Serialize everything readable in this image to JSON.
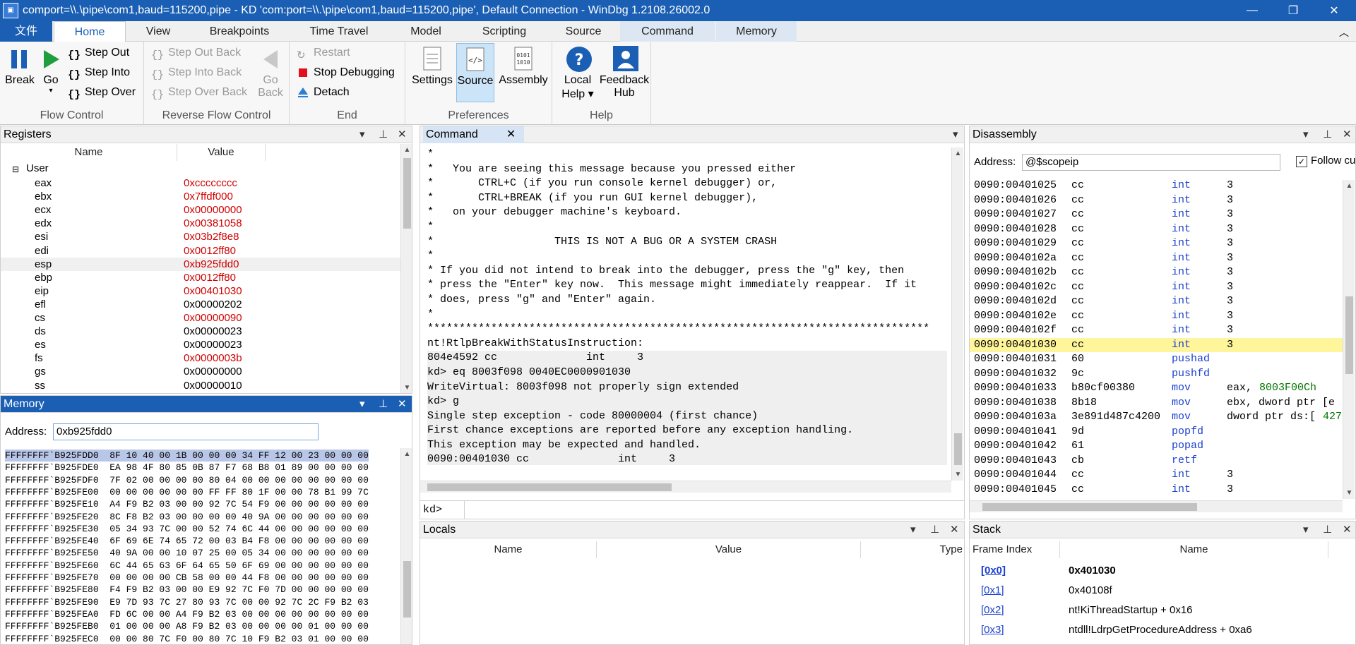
{
  "window": {
    "title": "comport=\\\\.\\pipe\\com1,baud=115200,pipe - KD 'com:port=\\\\.\\pipe\\com1,baud=115200,pipe', Default Connection  - WinDbg 1.2108.26002.0",
    "controls": [
      "—",
      "❐",
      "✕"
    ]
  },
  "ribbon_tabs": [
    "文件",
    "Home",
    "View",
    "Breakpoints",
    "Time Travel",
    "Model",
    "Scripting",
    "Source",
    "Command",
    "Memory"
  ],
  "ribbon": {
    "flow": {
      "label": "Flow Control",
      "break": "Break",
      "go": "Go",
      "step_out": "Step Out",
      "step_into": "Step Into",
      "step_over": "Step Over"
    },
    "reverse": {
      "label": "Reverse Flow Control",
      "step_out_back": "Step Out Back",
      "step_into_back": "Step Into Back",
      "step_over_back": "Step Over Back",
      "go_back_1": "Go",
      "go_back_2": "Back"
    },
    "end": {
      "label": "End",
      "restart": "Restart",
      "stop": "Stop Debugging",
      "detach": "Detach"
    },
    "prefs": {
      "label": "Preferences",
      "settings": "Settings",
      "source": "Source",
      "assembly": "Assembly"
    },
    "help": {
      "label": "Help",
      "local_help_1": "Local",
      "local_help_2": "Help ▾",
      "feedback_1": "Feedback",
      "feedback_2": "Hub"
    }
  },
  "registers": {
    "title": "Registers",
    "col_name": "Name",
    "col_value": "Value",
    "group": "User",
    "items": [
      [
        "eax",
        "0xcccccccc"
      ],
      [
        "ebx",
        "0x7ffdf000"
      ],
      [
        "ecx",
        "0x00000000"
      ],
      [
        "edx",
        "0x00381058"
      ],
      [
        "esi",
        "0x03b2f8e8"
      ],
      [
        "edi",
        "0x0012ff80"
      ],
      [
        "esp",
        "0xb925fdd0"
      ],
      [
        "ebp",
        "0x0012ff80"
      ],
      [
        "eip",
        "0x00401030"
      ],
      [
        "efl",
        "0x00000202"
      ],
      [
        "cs",
        "0x00000090"
      ],
      [
        "ds",
        "0x00000023"
      ],
      [
        "es",
        "0x00000023"
      ],
      [
        "fs",
        "0x0000003b"
      ],
      [
        "gs",
        "0x00000000"
      ],
      [
        "ss",
        "0x00000010"
      ]
    ]
  },
  "memory": {
    "title": "Memory",
    "address_label": "Address:",
    "address_value": "0xb925fdd0",
    "lines": [
      "FFFFFFFF`B925FDD0  8F 10 40 00 1B 00 00 00 34 FF 12 00 23 00 00 00",
      "FFFFFFFF`B925FDE0  EA 98 4F 80 85 0B 87 F7 68 B8 01 89 00 00 00 00",
      "FFFFFFFF`B925FDF0  7F 02 00 00 00 00 80 04 00 00 00 00 00 00 00 00",
      "FFFFFFFF`B925FE00  00 00 00 00 00 00 FF FF 80 1F 00 00 78 B1 99 7C",
      "FFFFFFFF`B925FE10  A4 F9 B2 03 00 00 92 7C 54 F9 00 00 00 00 00 00",
      "FFFFFFFF`B925FE20  8C F8 B2 03 00 00 00 00 40 9A 00 00 00 00 00 00",
      "FFFFFFFF`B925FE30  05 34 93 7C 00 00 52 74 6C 44 00 00 00 00 00 00",
      "FFFFFFFF`B925FE40  6F 69 6E 74 65 72 00 03 B4 F8 00 00 00 00 00 00",
      "FFFFFFFF`B925FE50  40 9A 00 00 10 07 25 00 05 34 00 00 00 00 00 00",
      "FFFFFFFF`B925FE60  6C 44 65 63 6F 64 65 50 6F 69 00 00 00 00 00 00",
      "FFFFFFFF`B925FE70  00 00 00 00 CB 58 00 00 44 F8 00 00 00 00 00 00",
      "FFFFFFFF`B925FE80  F4 F9 B2 03 00 00 E9 92 7C F0 7D 00 00 00 00 00",
      "FFFFFFFF`B925FE90  E9 7D 93 7C 27 80 93 7C 00 00 92 7C 2C F9 B2 03",
      "FFFFFFFF`B925FEA0  FD 6C 00 00 A4 F9 B2 03 00 00 00 00 00 00 00 00",
      "FFFFFFFF`B925FEB0  01 00 00 00 A8 F9 B2 03 00 00 00 00 01 00 00 00",
      "FFFFFFFF`B925FEC0  00 00 80 7C F0 00 80 7C 10 F9 B2 03 01 00 00 00"
    ]
  },
  "command": {
    "tab": "Command",
    "prompt": "kd>",
    "lines": [
      "*",
      "*   You are seeing this message because you pressed either",
      "*       CTRL+C (if you run console kernel debugger) or,",
      "*       CTRL+BREAK (if you run GUI kernel debugger),",
      "*   on your debugger machine's keyboard.",
      "*",
      "*                   THIS IS NOT A BUG OR A SYSTEM CRASH",
      "*",
      "* If you did not intend to break into the debugger, press the \"g\" key, then",
      "* press the \"Enter\" key now.  This message might immediately reappear.  If it",
      "* does, press \"g\" and \"Enter\" again.",
      "*",
      "*******************************************************************************",
      "nt!RtlpBreakWithStatusInstruction:",
      "804e4592 cc              int     3",
      "kd> eq 8003f098 0040EC0000901030",
      "WriteVirtual: 8003f098 not properly sign extended",
      "kd> g",
      "Single step exception - code 80000004 (first chance)",
      "First chance exceptions are reported before any exception handling.",
      "This exception may be expected and handled.",
      "0090:00401030 cc              int     3"
    ]
  },
  "disassembly": {
    "title": "Disassembly",
    "address_label": "Address:",
    "address_value": "@$scopeip",
    "follow": "Follow cu",
    "lines": [
      [
        "0090:00401025",
        "cc",
        "int",
        "3",
        ""
      ],
      [
        "0090:00401026",
        "cc",
        "int",
        "3",
        ""
      ],
      [
        "0090:00401027",
        "cc",
        "int",
        "3",
        ""
      ],
      [
        "0090:00401028",
        "cc",
        "int",
        "3",
        ""
      ],
      [
        "0090:00401029",
        "cc",
        "int",
        "3",
        ""
      ],
      [
        "0090:0040102a",
        "cc",
        "int",
        "3",
        ""
      ],
      [
        "0090:0040102b",
        "cc",
        "int",
        "3",
        ""
      ],
      [
        "0090:0040102c",
        "cc",
        "int",
        "3",
        ""
      ],
      [
        "0090:0040102d",
        "cc",
        "int",
        "3",
        ""
      ],
      [
        "0090:0040102e",
        "cc",
        "int",
        "3",
        ""
      ],
      [
        "0090:0040102f",
        "cc",
        "int",
        "3",
        ""
      ],
      [
        "0090:00401030",
        "cc",
        "int",
        "3",
        ""
      ],
      [
        "0090:00401031",
        "60",
        "pushad",
        "",
        ""
      ],
      [
        "0090:00401032",
        "9c",
        "pushfd",
        "",
        ""
      ],
      [
        "0090:00401033",
        "b80cf00380",
        "mov",
        "eax, ",
        "8003F00Ch"
      ],
      [
        "0090:00401038",
        "8b18",
        "mov",
        "ebx, dword ptr [e",
        ""
      ],
      [
        "0090:0040103a",
        "3e891d487c4200",
        "mov",
        "dword ptr ds:[",
        ""
      ],
      [
        "0090:00401041",
        "9d",
        "popfd",
        "",
        ""
      ],
      [
        "0090:00401042",
        "61",
        "popad",
        "",
        ""
      ],
      [
        "0090:00401043",
        "cb",
        "retf",
        "",
        ""
      ],
      [
        "0090:00401044",
        "cc",
        "int",
        "3",
        ""
      ],
      [
        "0090:00401045",
        "cc",
        "int",
        "3",
        ""
      ]
    ],
    "tail": "427"
  },
  "locals": {
    "title": "Locals",
    "col_name": "Name",
    "col_value": "Value",
    "col_type": "Type"
  },
  "stack": {
    "title": "Stack",
    "col_index": "Frame Index",
    "col_name": "Name",
    "rows": [
      [
        "[0x0]",
        "0x401030"
      ],
      [
        "[0x1]",
        "0x40108f"
      ],
      [
        "[0x2]",
        "nt!KiThreadStartup + 0x16"
      ],
      [
        "[0x3]",
        "ntdll!LdrpGetProcedureAddress + 0xa6"
      ]
    ]
  },
  "colors": {
    "accent": "#1a5fb4",
    "reg_changed": "#d00000",
    "keyword": "#1a3fd0",
    "number": "#007700",
    "current_line": "#fff59a"
  }
}
